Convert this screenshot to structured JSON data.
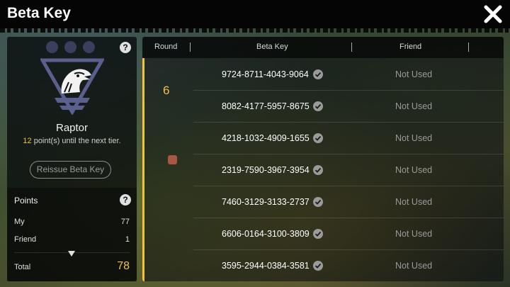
{
  "window": {
    "title": "Beta Key"
  },
  "tier": {
    "name": "Raptor",
    "points_needed": "12",
    "progress_suffix": " point(s) until the next tier.",
    "reissue_label": "Reissue Beta Key"
  },
  "points": {
    "header": "Points",
    "my_label": "My",
    "my_value": "77",
    "friend_label": "Friend",
    "friend_value": "1",
    "total_label": "Total",
    "total_value": "78"
  },
  "table": {
    "col_round": "Round",
    "col_key": "Beta Key",
    "col_friend": "Friend",
    "round_number": "6",
    "rows": [
      {
        "key": "9724-8711-4043-9064",
        "friend": "Not Used"
      },
      {
        "key": "8082-4177-5957-8675",
        "friend": "Not Used"
      },
      {
        "key": "4218-1032-4909-1655",
        "friend": "Not Used"
      },
      {
        "key": "2319-7590-3967-3954",
        "friend": "Not Used"
      },
      {
        "key": "7460-3129-3133-2737",
        "friend": "Not Used"
      },
      {
        "key": "6606-0164-3100-3809",
        "friend": "Not Used"
      },
      {
        "key": "3595-2944-0384-3581",
        "friend": "Not Used"
      }
    ]
  },
  "icons": {
    "close": "close-icon",
    "help": "help-icon",
    "check": "check-circle-icon",
    "emblem": "raptor-emblem-icon",
    "expand": "chevron-down-icon"
  },
  "colors": {
    "accent": "#f3c23a",
    "emblem": "#5b5f8e",
    "tier_dot": "#3a3f5e",
    "marker": "#a75743"
  }
}
